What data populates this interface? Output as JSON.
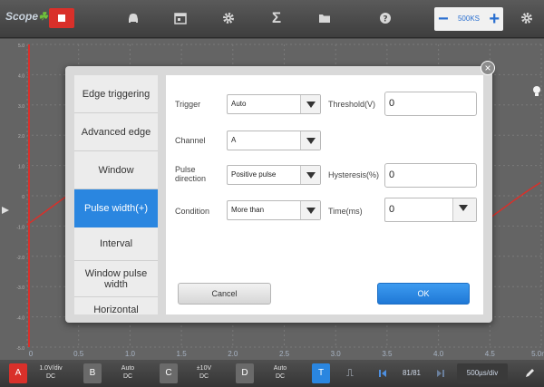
{
  "toolbar": {
    "logo": "Scope",
    "icons": [
      "stop-icon",
      "car-icon",
      "calendar-icon",
      "gear-icon",
      "sigma-icon",
      "folder-icon",
      "help-icon",
      "settings-icon"
    ],
    "sigma_glyph": "Σ",
    "sample_rate": "500KS",
    "minus": "−",
    "plus": "+"
  },
  "scope": {
    "y_ticks": [
      "5.0",
      "4.0",
      "3.0",
      "2.0",
      "1.0",
      "0",
      "-1.0",
      "-2.0",
      "-3.0",
      "-4.0",
      "-5.0"
    ],
    "x_ticks": [
      "0",
      "0.5",
      "1.0",
      "1.5",
      "2.0",
      "2.5",
      "3.0",
      "3.5",
      "4.0",
      "4.5",
      "5.0ms"
    ]
  },
  "dialog": {
    "close": "×",
    "trigger_types": [
      {
        "label": "Edge triggering"
      },
      {
        "label": "Advanced edge"
      },
      {
        "label": "Window"
      },
      {
        "label": "Pulse width(+)"
      },
      {
        "label": "Interval"
      },
      {
        "label": "Window pulse width"
      },
      {
        "label": "Horizontal"
      }
    ],
    "selected_trigger": "Pulse width(+)",
    "fields": {
      "trigger": {
        "label": "Trigger",
        "value": "Auto"
      },
      "channel": {
        "label": "Channel",
        "value": "A"
      },
      "pulse_direction": {
        "label": "Pulse direction",
        "value": "Positive pulse"
      },
      "condition": {
        "label": "Condition",
        "value": "More than"
      },
      "threshold": {
        "label": "Threshold(V)",
        "value": "0"
      },
      "hysteresis": {
        "label": "Hysteresis(%)",
        "value": "0"
      },
      "time": {
        "label": "Time(ms)",
        "value": "0"
      }
    },
    "cancel_label": "Cancel",
    "ok_label": "OK"
  },
  "bottom": {
    "channels": [
      {
        "name": "A",
        "scale": "1.0V/div",
        "coupling": "DC",
        "color": "#d9302a"
      },
      {
        "name": "B",
        "scale": "Auto",
        "coupling": "DC",
        "color": "#6a6a6a"
      },
      {
        "name": "C",
        "scale": "±10V",
        "coupling": "DC",
        "color": "#6a6a6a"
      },
      {
        "name": "D",
        "scale": "Auto",
        "coupling": "DC",
        "color": "#6a6a6a"
      }
    ],
    "trigger_badge": "T",
    "pulse_symbol": "⎍",
    "page": "81/81",
    "timebase": "500µs/div"
  },
  "colors": {
    "accent": "#2a86e0",
    "waveform": "#d9302a",
    "ok_button": "#1f78d6"
  }
}
